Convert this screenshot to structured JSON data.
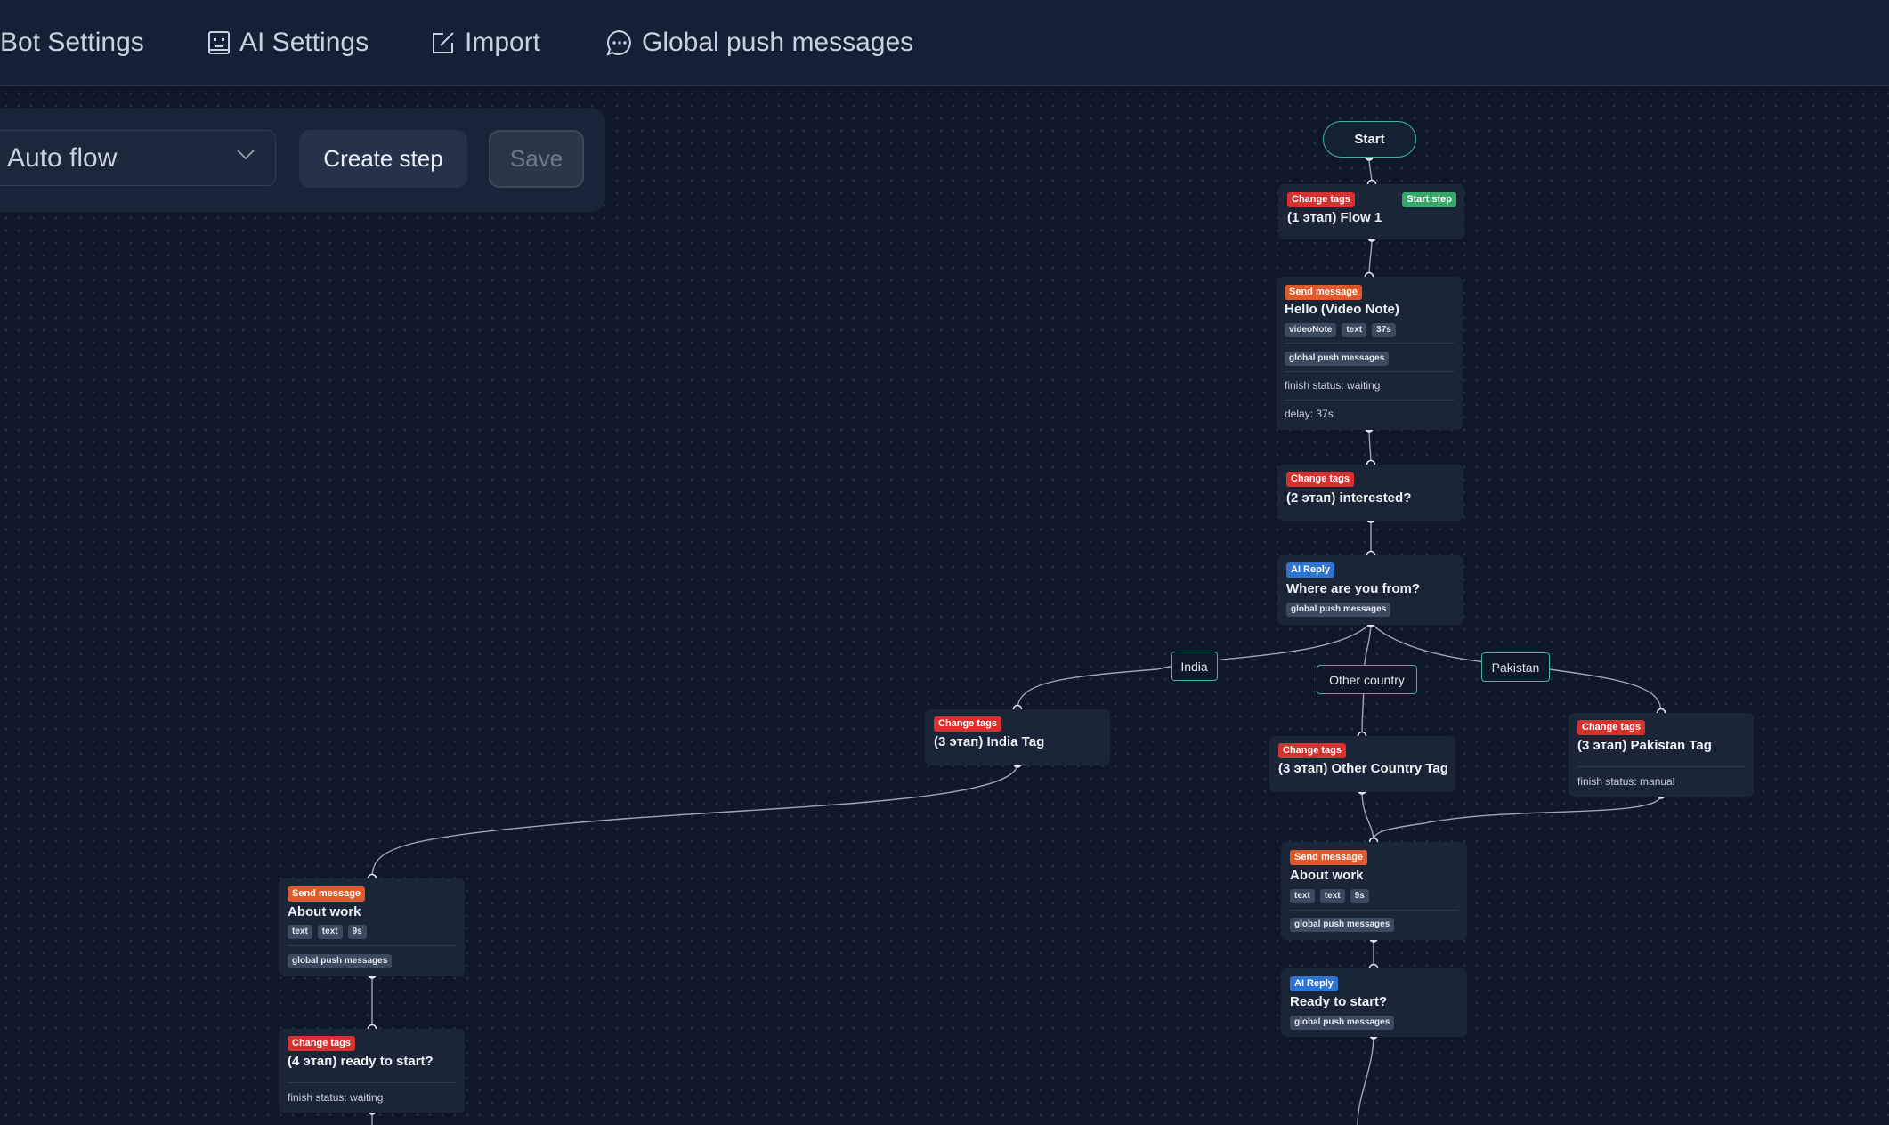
{
  "nav": {
    "bot_settings": "Bot Settings",
    "ai_settings": "AI Settings",
    "import": "Import",
    "global_push": "Global push messages"
  },
  "toolbar": {
    "flow_select": "Auto flow",
    "create_step": "Create step",
    "save": "Save"
  },
  "flow": {
    "start": "Start",
    "edge_labels": {
      "india": "India",
      "other": "Other country",
      "pakistan": "Pakistan"
    },
    "nodes": {
      "flow1": {
        "badge": "Change tags",
        "badge2": "Start step",
        "title": "(1 этап) Flow 1"
      },
      "hello": {
        "badge": "Send message",
        "title": "Hello (Video Note)",
        "chips": [
          "videoNote",
          "text",
          "37s"
        ],
        "tag": "global push messages",
        "finish": "finish status: waiting",
        "delay": "delay: 37s"
      },
      "interested": {
        "badge": "Change tags",
        "title": "(2 этап) interested?"
      },
      "where": {
        "badge": "AI Reply",
        "title": "Where are you from?",
        "tag": "global push messages"
      },
      "india": {
        "badge": "Change tags",
        "title": "(3 этап) India Tag"
      },
      "other": {
        "badge": "Change tags",
        "title": "(3 этап) Other Country Tag"
      },
      "pakistan": {
        "badge": "Change tags",
        "title": "(3 этап) Pakistan Tag",
        "finish": "finish status: manual"
      },
      "about_right": {
        "badge": "Send message",
        "title": "About work",
        "chips": [
          "text",
          "text",
          "9s"
        ],
        "tag": "global push messages"
      },
      "ready_right": {
        "badge": "AI Reply",
        "title": "Ready to start?",
        "tag": "global push messages"
      },
      "about_left": {
        "badge": "Send message",
        "title": "About work",
        "chips": [
          "text",
          "text",
          "9s"
        ],
        "tag": "global push messages"
      },
      "ready_left": {
        "badge": "Change tags",
        "title": "(4 этап) ready to start?",
        "finish": "finish status: waiting"
      }
    }
  },
  "colors": {
    "background": "#0f1829",
    "accent": "#3fb89a",
    "change_tags": "#d5312f",
    "send_message": "#e0592a",
    "ai_reply": "#2f74d0",
    "start_step": "#37a86a"
  }
}
